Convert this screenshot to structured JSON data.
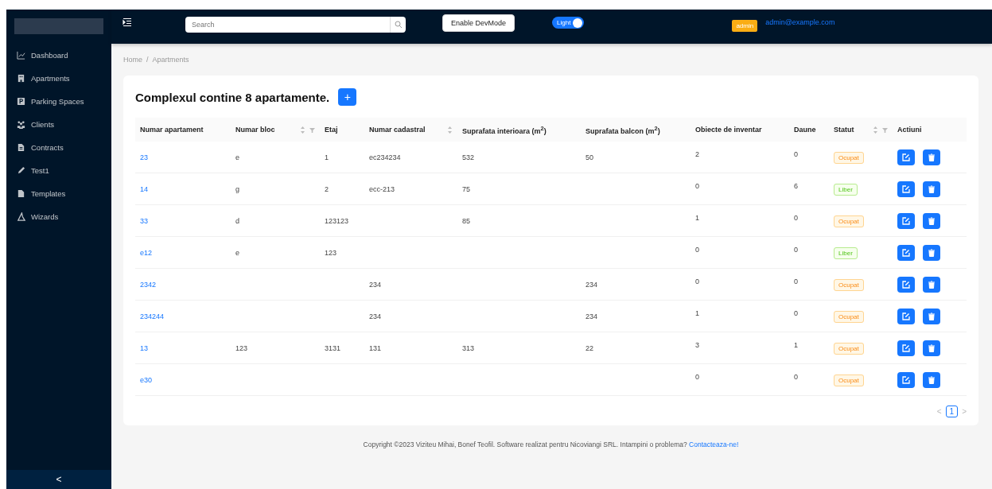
{
  "sidebar": {
    "items": [
      {
        "label": "Dashboard",
        "selected": false
      },
      {
        "label": "Apartments",
        "selected": false
      },
      {
        "label": "Parking Spaces",
        "selected": false
      },
      {
        "label": "Clients",
        "selected": false
      },
      {
        "label": "Contracts",
        "selected": false
      },
      {
        "label": "Test1",
        "selected": false
      },
      {
        "label": "Templates",
        "selected": false
      },
      {
        "label": "Wizards",
        "selected": false
      }
    ],
    "collapse": "<"
  },
  "topbar": {
    "search": {
      "placeholder": "Search"
    },
    "devmode_button": "Enable DevMode",
    "theme_switch": {
      "label": "Light",
      "on": true
    },
    "role_badge": "admin",
    "user_email": "admin@example.com"
  },
  "breadcrumb": {
    "items": [
      "Home",
      "Apartments"
    ],
    "separator": "/"
  },
  "heading": "Complexul contine 8 apartamente.",
  "add_button": "+",
  "table": {
    "columns": [
      {
        "label": "Numar apartament",
        "sortable": false,
        "filterable": false
      },
      {
        "label": "Numar bloc",
        "sortable": true,
        "filterable": true
      },
      {
        "label": "Etaj",
        "sortable": false,
        "filterable": false
      },
      {
        "label": "Numar cadastral",
        "sortable": true,
        "filterable": false
      },
      {
        "label": "Suprafata interioara (m$^{2}$)",
        "sortable": false,
        "filterable": false
      },
      {
        "label": "Suprafata balcon (m$^{2}$)",
        "sortable": false,
        "filterable": false
      },
      {
        "label": "Obiecte de inventar",
        "sortable": false,
        "filterable": false
      },
      {
        "label": "Daune",
        "sortable": false,
        "filterable": false
      },
      {
        "label": "Statut",
        "sortable": true,
        "filterable": true
      },
      {
        "label": "Actiuni",
        "sortable": false,
        "filterable": false
      }
    ],
    "rows": [
      {
        "cells": [
          "23",
          "e",
          "1",
          "ec234234",
          "532",
          "50",
          "2",
          "0"
        ],
        "status": {
          "label": "Ocupat",
          "kind": "occupied"
        }
      },
      {
        "cells": [
          "14",
          "g",
          "2",
          "ecc-213",
          "75",
          "",
          "0",
          "6"
        ],
        "status": {
          "label": "Liber",
          "kind": "free"
        }
      },
      {
        "cells": [
          "33",
          "d",
          "123123",
          "",
          "85",
          "",
          "1",
          "0"
        ],
        "status": {
          "label": "Ocupat",
          "kind": "occupied"
        }
      },
      {
        "cells": [
          "e12",
          "e",
          "123",
          "",
          "",
          "",
          "0",
          "0"
        ],
        "status": {
          "label": "Liber",
          "kind": "free"
        }
      },
      {
        "cells": [
          "2342",
          "",
          "",
          "234",
          "",
          "234",
          "0",
          "0"
        ],
        "status": {
          "label": "Ocupat",
          "kind": "occupied"
        }
      },
      {
        "cells": [
          "234244",
          "",
          "",
          "234",
          "",
          "234",
          "1",
          "0"
        ],
        "status": {
          "label": "Ocupat",
          "kind": "occupied"
        }
      },
      {
        "cells": [
          "13",
          "123",
          "3131",
          "131",
          "313",
          "22",
          "3",
          "1"
        ],
        "status": {
          "label": "Ocupat",
          "kind": "occupied"
        }
      },
      {
        "cells": [
          "e30",
          "",
          "",
          "",
          "",
          "",
          "0",
          "0"
        ],
        "status": {
          "label": "Ocupat",
          "kind": "occupied"
        }
      }
    ]
  },
  "pagination": {
    "prev": "<",
    "pages": [
      {
        "label": "1",
        "selected": true
      }
    ],
    "next": ">"
  },
  "footer": {
    "text": "Copyright ©2023 Viziteu Mihai, Bonef Teofil. Software realizat pentru Nicoviangi SRL. Intampini o problema?",
    "link": "Contacteaza-ne!"
  }
}
